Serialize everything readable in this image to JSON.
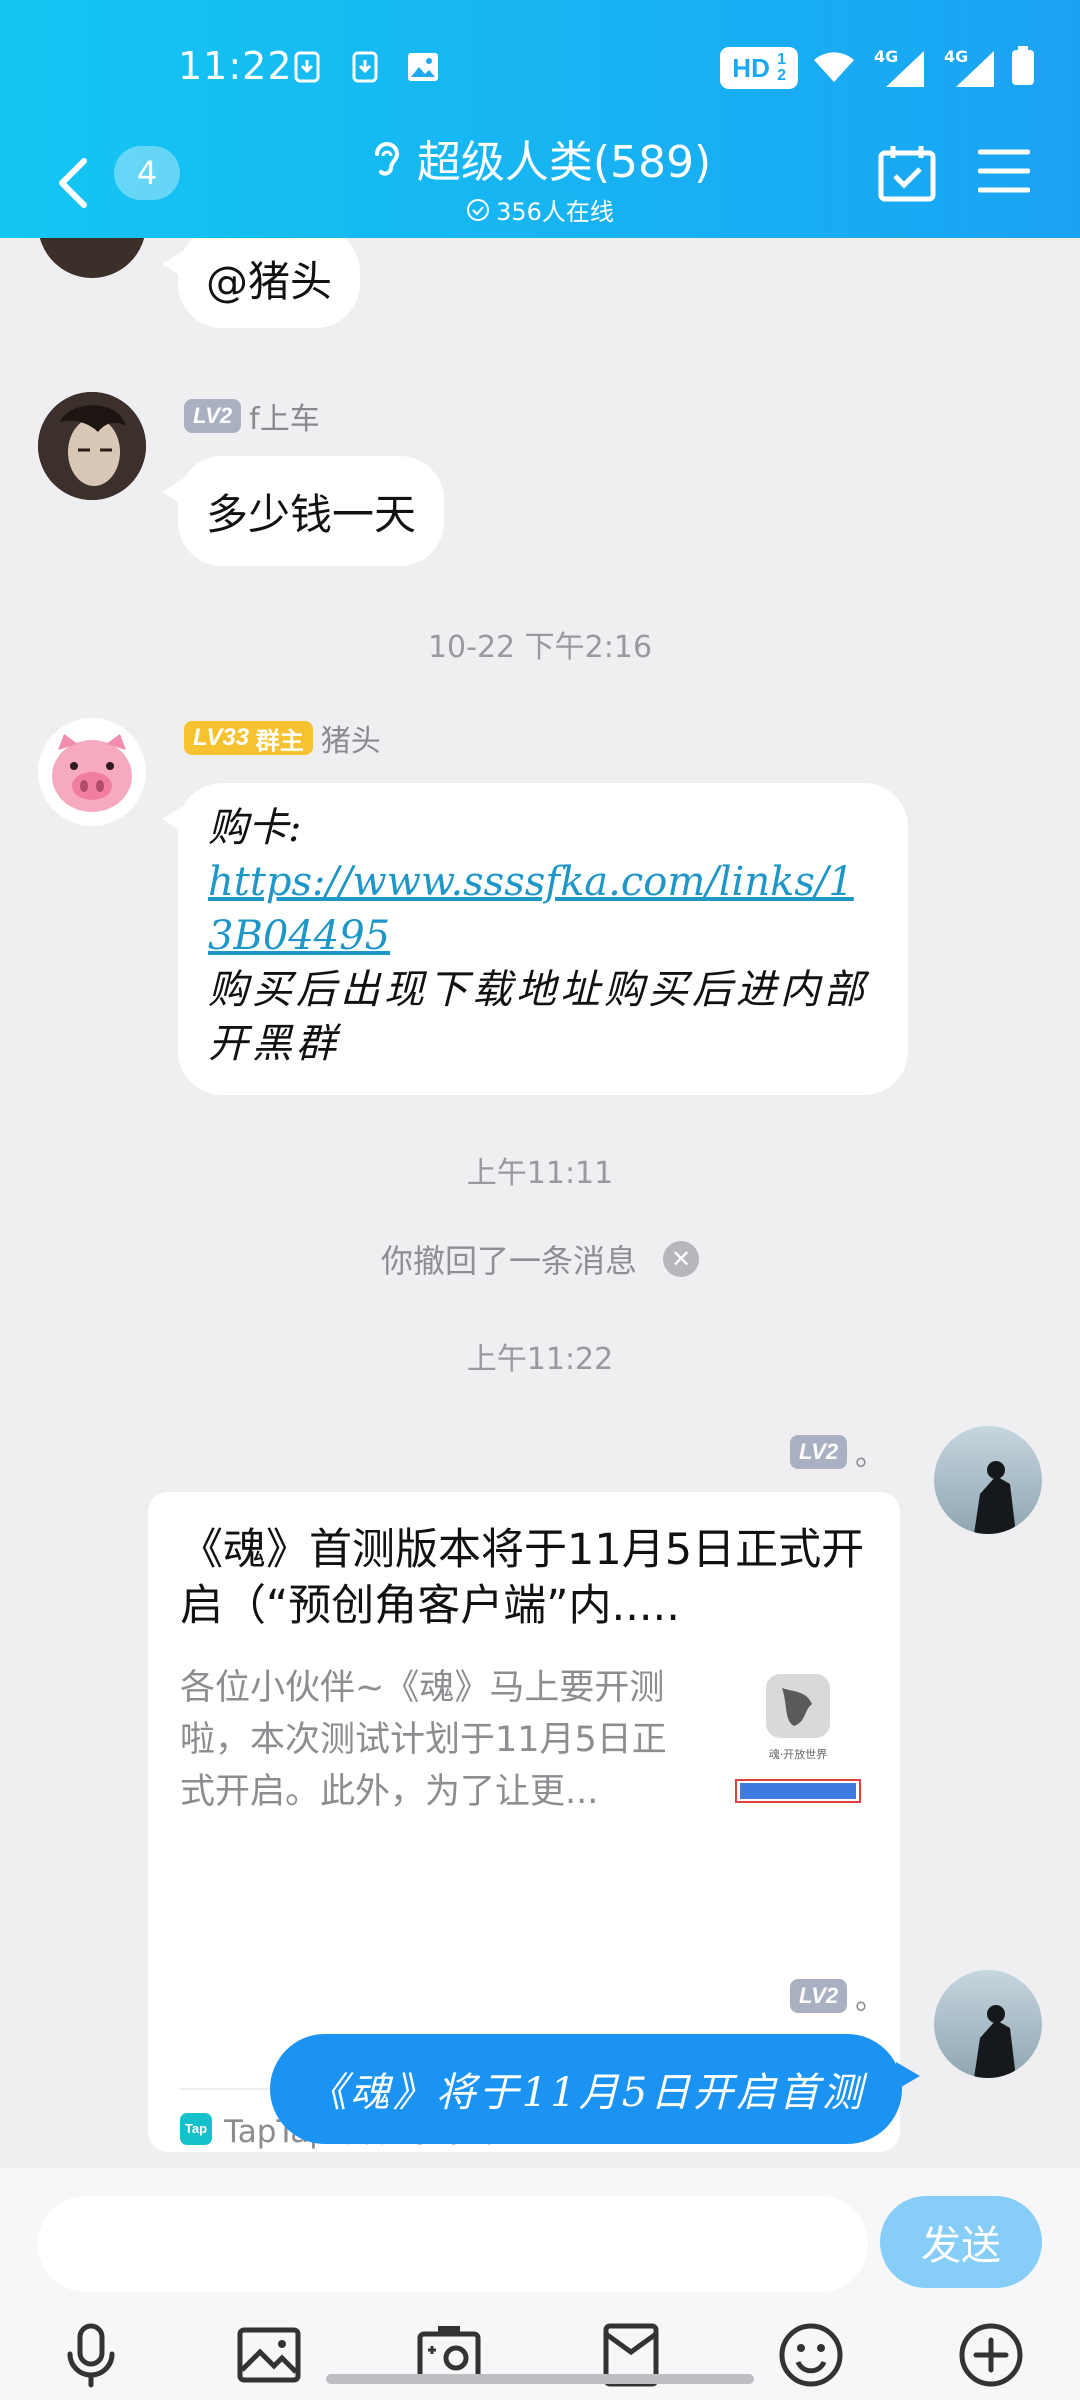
{
  "status_bar": {
    "time": "11:22",
    "hd_label": "HD",
    "network_labels": [
      "4G",
      "4G"
    ],
    "icons": [
      "download-icon",
      "download-icon",
      "image-icon",
      "wifi-icon",
      "signal-icon",
      "signal-icon",
      "battery-icon"
    ]
  },
  "nav": {
    "unread_count": "4",
    "title": "超级人类(589)",
    "online": "356人在线"
  },
  "messages": {
    "m1": {
      "text": "@猪头"
    },
    "m2": {
      "level": "LV2",
      "sender": "f上车",
      "text": "多少钱一天"
    },
    "t1": "10-22 下午2:16",
    "m3": {
      "level": "LV33",
      "role": "群主",
      "sender": "猪头",
      "line1": "购卡:",
      "link": "https://www.ssssfka.com/links/13B04495",
      "line2": "购买后出现下载地址购买后进内部开黑群"
    },
    "t2": "上午11:11",
    "recall": "你撤回了一条消息",
    "t3": "上午11:22",
    "m4": {
      "level": "LV2",
      "sender": "。",
      "card_title": "《魂》首测版本将于11月5日正式开启（“预创角客户端”内.....",
      "card_desc": "各位小伙伴~《魂》马上要开测啦，本次测试计划于11月5日正式开启。此外，为了让更...",
      "thumb_caption": "魂·开放世界",
      "source": "TapTap 发现好游戏",
      "source_logo": "Tap"
    },
    "m5": {
      "level": "LV2",
      "sender": "。",
      "text": "《魂》将于11月5日开启首测"
    }
  },
  "input": {
    "send_label": "发送"
  },
  "toolbar": [
    "microphone-icon",
    "image-icon",
    "camera-icon",
    "red-packet-icon",
    "emoji-icon",
    "plus-icon"
  ],
  "colors": {
    "header_start": "#14c6f2",
    "header_end": "#1aa3f3",
    "bubble_blue": "#1b93f2",
    "send_button": "#86cef7",
    "owner_badge": "#f6c22f"
  }
}
